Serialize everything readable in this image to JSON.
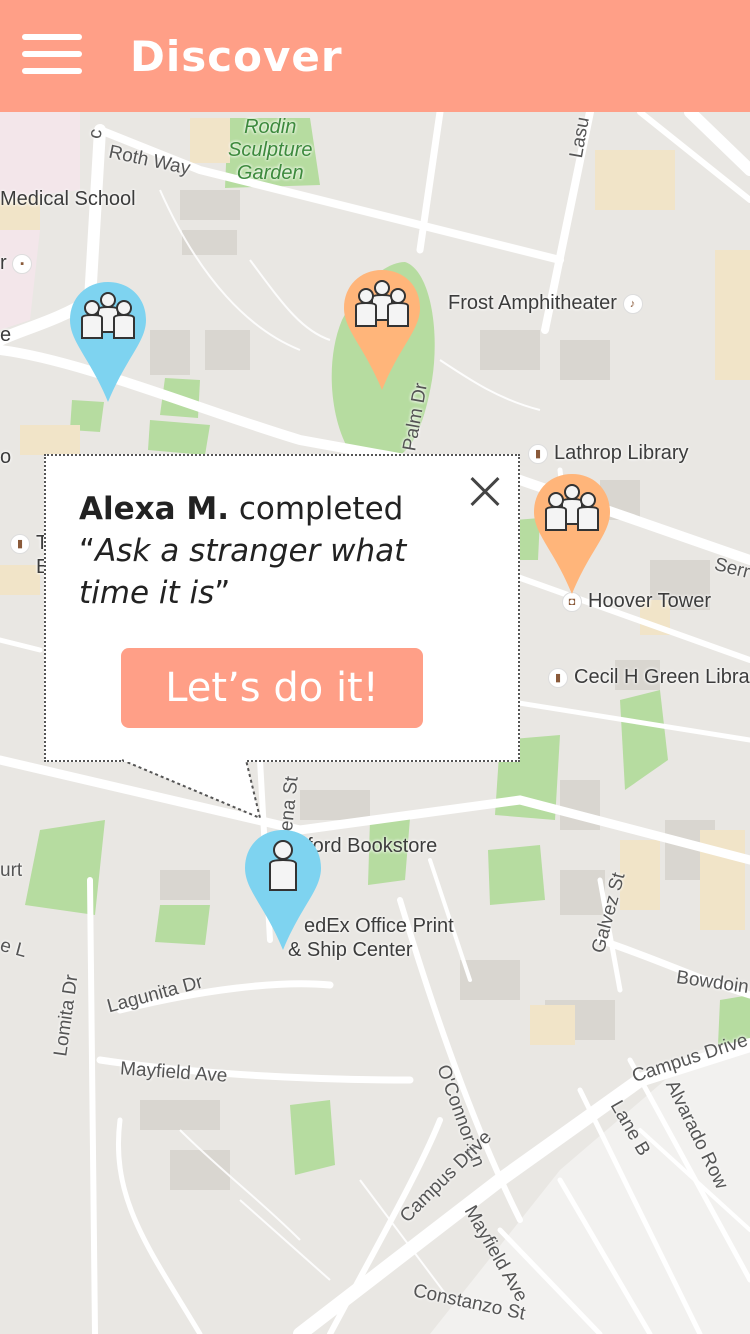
{
  "header": {
    "title": "Discover",
    "bg_color": "#ff9f87",
    "menu_icon": "hamburger-menu-icon"
  },
  "map": {
    "labels": {
      "rodin": "Rodin\nSculpture\nGarden",
      "roth_way": "Roth Way",
      "medical_school": "Medical School",
      "frost": "Frost Amphitheater",
      "lathrop": "Lathrop Library",
      "hoover": "Hoover Tower",
      "cecil": "Cecil H Green Libra",
      "bookstore": "nford Bookstore",
      "fedex_line1": "edEx Office Print",
      "fedex_line2": "& Ship Center",
      "lagunita": "Lagunita Dr",
      "mayfield": "Mayfield Ave",
      "mayfield2": "Mayfield Ave",
      "lomita": "Lomita Dr",
      "oconnor": "O'Connor Ln",
      "galvez": "Galvez St",
      "bowdoin": "Bowdoin",
      "campus_drive_e": "Campus Drive",
      "campus_drive_s": "Campus Drive",
      "alvarado": "Alvarado Row",
      "lane_b": "Lane B",
      "constanzo": "Constanzo St",
      "palm_dr": "Palm Dr",
      "lasuen": "Lasu",
      "serra": "Serr",
      "urt": "urt",
      "e_l": "e L",
      "r": "r",
      "e": "e",
      "t": "T",
      "E": "E",
      "o": "o",
      "c": "c",
      "ena_st": "ena St"
    },
    "pin_colors": {
      "blue": "#7ed3f0",
      "orange": "#ffb57a"
    }
  },
  "popup": {
    "user": "Alexa M.",
    "verb": " completed",
    "open_quote": "“",
    "task": "Ask a stranger what time it is",
    "close_quote": "”",
    "cta_label": "Let’s do it!",
    "cta_color": "#ff9f87"
  }
}
